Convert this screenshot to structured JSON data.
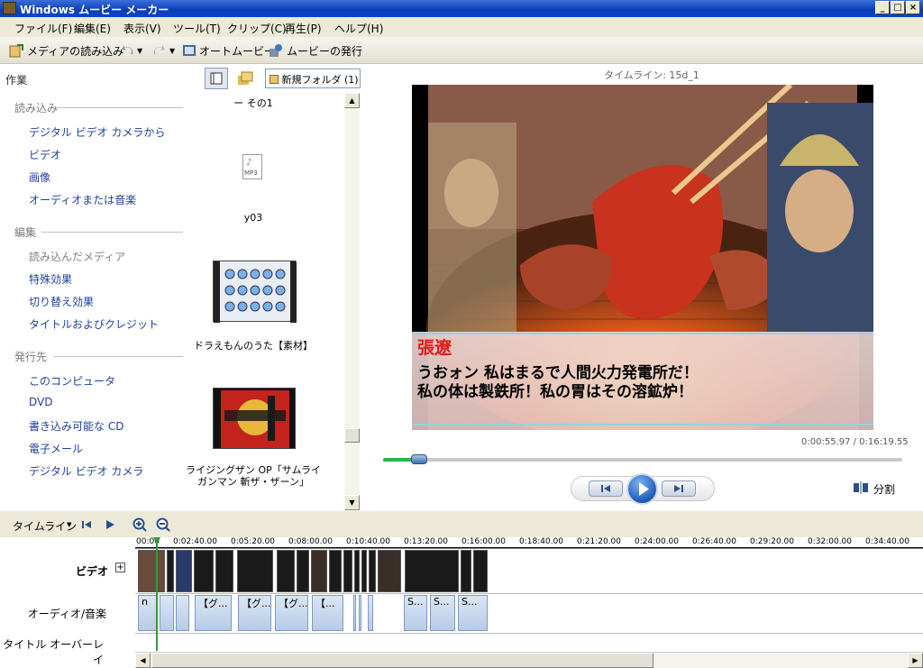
{
  "window": {
    "title": "Windows ムービー メーカー"
  },
  "menu": [
    "ファイル(F)",
    "編集(E)",
    "表示(V)",
    "ツール(T)",
    "クリップ(C)",
    "再生(P)",
    "ヘルプ(H)"
  ],
  "toolbar": {
    "import_media": "メディアの読み込み",
    "auto_movie": "オートムービー",
    "publish_movie": "ムービーの発行"
  },
  "tasks": {
    "title": "作業",
    "import_header": "読み込み",
    "import_items": [
      "デジタル ビデオ カメラから",
      "ビデオ",
      "画像",
      "オーディオまたは音楽"
    ],
    "edit_header": "編集",
    "edit_items": [
      "読み込んだメディア",
      "特殊効果",
      "切り替え効果",
      "タイトルおよびクレジット"
    ],
    "publish_header": "発行先",
    "publish_items": [
      "このコンピュータ",
      "DVD",
      "書き込み可能な CD",
      "電子メール",
      "デジタル ビデオ カメラ"
    ]
  },
  "collection": {
    "folder": "新規フォルダ (1)",
    "top_caption": "ー その1",
    "items": [
      {
        "caption": "y03"
      },
      {
        "caption": "ドラえもんのうた【素材】"
      },
      {
        "caption": "ライジングザン OP「サムライガンマン 斬ザ・ザーン」"
      }
    ],
    "mp3_label": "MP3"
  },
  "preview": {
    "label": "タイムライン: 15d_1",
    "subtitle_name": "張遼",
    "subtitle_line1": "うおォン 私はまるで人間火力発電所だ！",
    "subtitle_line2": "私の体は製鉄所！私の胃はその溶鉱炉！",
    "time": "0:00:55.97 / 0:16:19.55",
    "progress": 0.07,
    "split_label": "分割"
  },
  "timeline": {
    "view_label": "タイムライン",
    "ruler": [
      "00:00",
      "0:02:40.00",
      "0:05:20.00",
      "0:08:00.00",
      "0:10:40.00",
      "0:13:20.00",
      "0:16:00.00",
      "0:18:40.00",
      "0:21:20.00",
      "0:24:00.00",
      "0:26:40.00",
      "0:29:20.00",
      "0:32:00.00",
      "0:34:40.00"
    ],
    "video_label": "ビデオ",
    "audio_label": "オーディオ/音楽",
    "title_label": "タイトル オーバーレイ",
    "audio_clips": [
      "n",
      "",
      "",
      "【グ...",
      "【グ...",
      "【グ...",
      "【...",
      "S...",
      "S...",
      "S..."
    ]
  },
  "colors": {
    "accent": "#1f3f9f",
    "subtitle_name": "#e31b1b"
  }
}
